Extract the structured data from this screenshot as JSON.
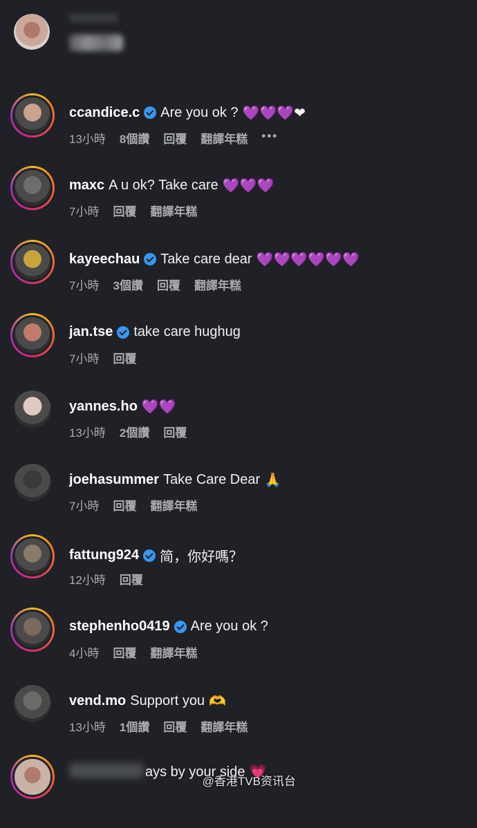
{
  "post_header": {},
  "comments": [
    {
      "username": "ccandice.c",
      "verified": true,
      "text": "Are you ok ?",
      "emoji": "💜💜💜❤",
      "time": "13小時",
      "likes": "8個讚",
      "reply": "回覆",
      "translate": "翻譯年糕",
      "more": "•••",
      "avatar_color": "#c9a38a"
    },
    {
      "username": "maxc",
      "verified": false,
      "text": "A u ok? Take care",
      "emoji": "💜💜💜",
      "time": "7小時",
      "likes": "",
      "reply": "回覆",
      "translate": "翻譯年糕",
      "avatar_color": "#6d6d6d"
    },
    {
      "username": "kayeechau",
      "verified": true,
      "text": "Take care dear",
      "emoji": "💜💜💜💜💜💜",
      "time": "7小時",
      "likes": "3個讚",
      "reply": "回覆",
      "translate": "翻譯年糕",
      "avatar_color": "#c8a43a"
    },
    {
      "username": "jan.tse",
      "verified": true,
      "text": "take care hughug",
      "emoji": "",
      "time": "7小時",
      "likes": "",
      "reply": "回覆",
      "translate": "",
      "avatar_color": "#c27b6a"
    },
    {
      "username": "yannes.ho",
      "verified": false,
      "text": "",
      "emoji": "💜💜",
      "time": "13小時",
      "likes": "2個讚",
      "reply": "回覆",
      "translate": "",
      "avatar_color": "#e0c9c0"
    },
    {
      "username": "joehasummer",
      "verified": false,
      "text": "Take Care Dear",
      "emoji": "🙏",
      "time": "7小時",
      "likes": "",
      "reply": "回覆",
      "translate": "翻譯年糕",
      "avatar_color": "#3a3a3a"
    },
    {
      "username": "fattung924",
      "verified": true,
      "text": "简，你好嗎？",
      "emoji": "",
      "time": "12小時",
      "likes": "",
      "reply": "回覆",
      "translate": "",
      "avatar_color": "#8a7a68"
    },
    {
      "username": "stephenho0419",
      "verified": true,
      "text": "Are you ok ?",
      "emoji": "",
      "time": "4小時",
      "likes": "",
      "reply": "回覆",
      "translate": "翻譯年糕",
      "avatar_color": "#7a6a5e"
    },
    {
      "username": "vend.mo",
      "verified": false,
      "text": "Support you",
      "emoji": "🫶",
      "time": "13小時",
      "likes": "1個讚",
      "reply": "回覆",
      "translate": "翻譯年糕",
      "avatar_color": "#6a6a66"
    }
  ],
  "last_comment_partial": {
    "text": "ays by your side",
    "emoji": "💗"
  },
  "watermark": "@香港TVB资讯台"
}
